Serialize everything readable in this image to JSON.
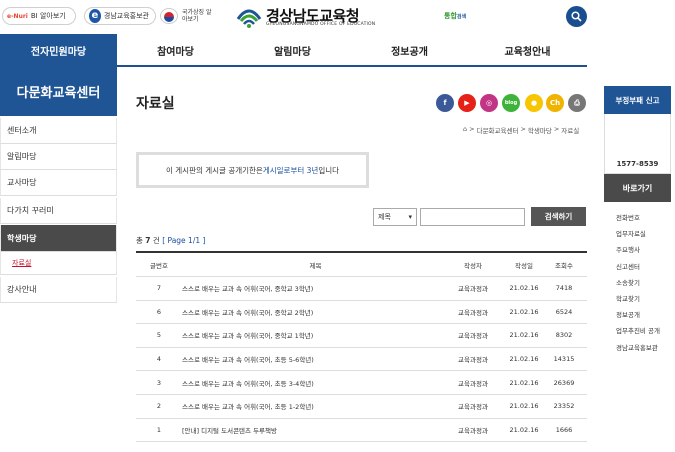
{
  "top": {
    "pill1_logo": "e-Nuri",
    "pill1_label": "BI 알아보기",
    "pill2_label": "경남교육홍보관",
    "flag_text": "국가상징 알아보기",
    "logo_title": "경상남도교육청",
    "logo_sub": "GYEONGSANGNAMDO OFFICE OF EDUCATION",
    "tonghap_a": "통합",
    "tonghap_b": "검색"
  },
  "gnb": [
    "전자민원마당",
    "참여마당",
    "알림마당",
    "정보공개",
    "교육청안내"
  ],
  "lnb": {
    "title": "다문화교육센터",
    "items": [
      "센터소개",
      "알림마당",
      "교사마당",
      "다가치 꾸러미",
      "학생마당"
    ],
    "sub_active": "자료실",
    "last": "강사안내"
  },
  "content": {
    "title": "자료실",
    "breadcrumb": [
      "다문화교육센터",
      "학생마당",
      "자료실"
    ],
    "notice_pre": "이 게시판의 게시글 공개기한은 ",
    "notice_hl": "게시일로부터 3년",
    "notice_post": "입니다",
    "search_select": "제목",
    "search_button": "검색하기",
    "count_pre": "총 ",
    "count_num": "7",
    "count_post": " 건",
    "page_info": "[ Page 1/1 ]",
    "headers": {
      "no": "글번호",
      "title": "제목",
      "writer": "작성자",
      "date": "작성일",
      "views": "조회수"
    },
    "rows": [
      {
        "no": "7",
        "title": "스스로 배우는 교과 속 어휘(국어, 중학교 3학년)",
        "writer": "교육과정과",
        "date": "21.02.16",
        "views": "7418"
      },
      {
        "no": "6",
        "title": "스스로 배우는 교과 속 어휘(국어, 중학교 2학년)",
        "writer": "교육과정과",
        "date": "21.02.16",
        "views": "6524"
      },
      {
        "no": "5",
        "title": "스스로 배우는 교과 속 어휘(국어, 중학교 1학년)",
        "writer": "교육과정과",
        "date": "21.02.16",
        "views": "8302"
      },
      {
        "no": "4",
        "title": "스스로 배우는 교과 속 어휘(국어, 초등 5-6학년)",
        "writer": "교육과정과",
        "date": "21.02.16",
        "views": "14315"
      },
      {
        "no": "3",
        "title": "스스로 배우는 교과 속 어휘(국어, 초등 3-4학년)",
        "writer": "교육과정과",
        "date": "21.02.16",
        "views": "26369"
      },
      {
        "no": "2",
        "title": "스스로 배우는 교과 속 어휘(국어, 초등 1-2학년)",
        "writer": "교육과정과",
        "date": "21.02.16",
        "views": "23352"
      },
      {
        "no": "1",
        "title": "[안내] 디지털 도서콘텐츠 두루책방",
        "writer": "교육과정과",
        "date": "21.02.16",
        "views": "1666"
      }
    ]
  },
  "sns": [
    {
      "name": "facebook-icon",
      "glyph": "f",
      "color": "#3b5998"
    },
    {
      "name": "youtube-icon",
      "glyph": "▶",
      "color": "#e62117"
    },
    {
      "name": "instagram-icon",
      "glyph": "◎",
      "color": "#c13584"
    },
    {
      "name": "blog-icon",
      "glyph": "blog",
      "color": "#3db33a"
    },
    {
      "name": "kakao-icon",
      "glyph": "●",
      "color": "#f7c600"
    },
    {
      "name": "kakao-channel-icon",
      "glyph": "Ch",
      "color": "#f0b400"
    },
    {
      "name": "print-icon",
      "glyph": "⎙",
      "color": "#777777"
    }
  ],
  "right": {
    "report_title": "부정부패 신고",
    "phone": "1577-8539",
    "shortcut_title": "바로가기",
    "links": [
      "전화번호",
      "업무자료실",
      "주요행사",
      "신고센터",
      "소송찾기",
      "학교찾기",
      "정보공개",
      "업무추진비 공개",
      "경남교육홍보관"
    ]
  },
  "colors": {
    "brand": "#1f5495",
    "dark": "#4a4a4a",
    "accent": "#c8102e"
  }
}
